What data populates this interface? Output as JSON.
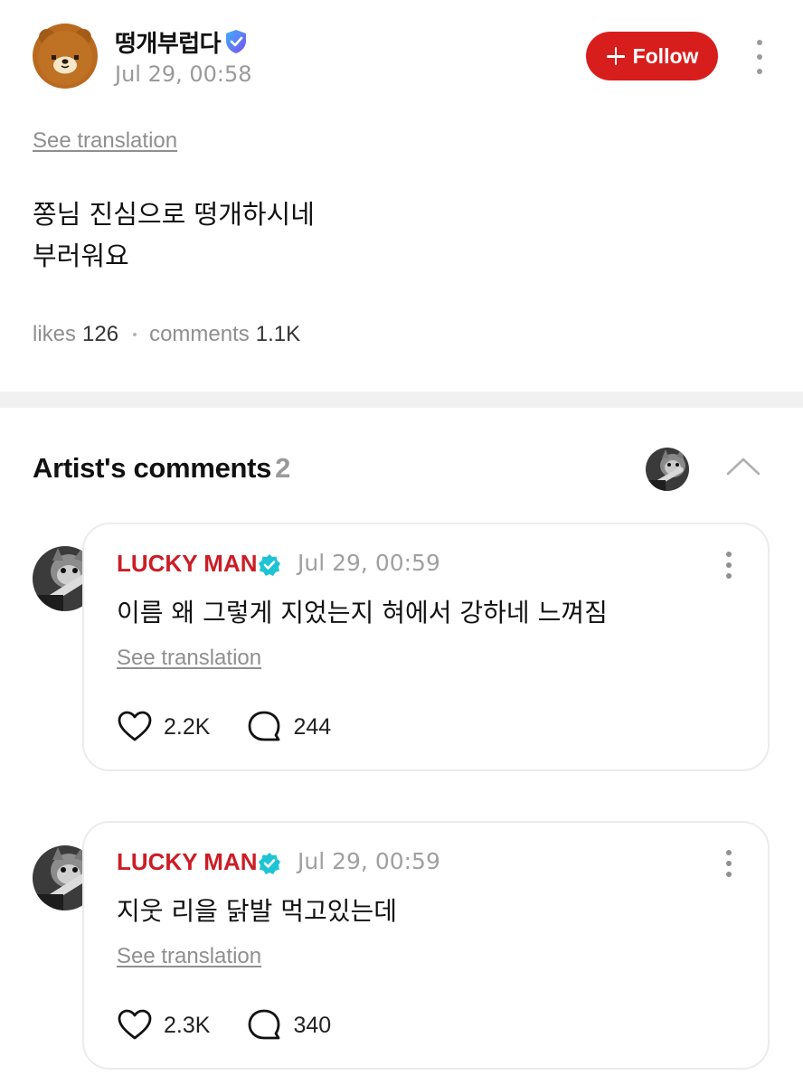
{
  "post": {
    "author": "떵개부럽다",
    "time": "Jul 29, 00:58",
    "follow_label": "Follow",
    "see_translation": "See translation",
    "body_lines": [
      "쫑님 진심으로 떵개하시네",
      "부러워요"
    ],
    "likes_label": "likes",
    "likes_count": "126",
    "comments_label": "comments",
    "comments_count": "1.1K"
  },
  "artist_comments": {
    "title": "Artist's comments",
    "count": "2",
    "items": [
      {
        "author": "LUCKY MAN",
        "time": "Jul 29, 00:59",
        "text": "이름 왜 그렇게 지었는지 혀에서 강하네 느껴짐",
        "see_translation": "See translation",
        "likes": "2.2K",
        "replies": "244"
      },
      {
        "author": "LUCKY MAN",
        "time": "Jul 29, 00:59",
        "text": "지웃 리을 닭발 먹고있는데",
        "see_translation": "See translation",
        "likes": "2.3K",
        "replies": "340"
      }
    ]
  },
  "colors": {
    "follow_button": "#d81d1d",
    "artist_name": "#cc1d26",
    "verified_shield": "#5b6ef0",
    "artist_check": "#1fc4d4",
    "muted_text": "#8f8f8f"
  },
  "icons": {
    "post_avatar": "bear-avatar-icon",
    "verified": "verified-shield-icon",
    "follow": "plus-icon",
    "more": "more-vertical-icon",
    "collapse": "chevron-up-icon",
    "artist_check": "verified-check-icon",
    "like": "heart-icon",
    "reply": "speech-bubble-icon"
  }
}
